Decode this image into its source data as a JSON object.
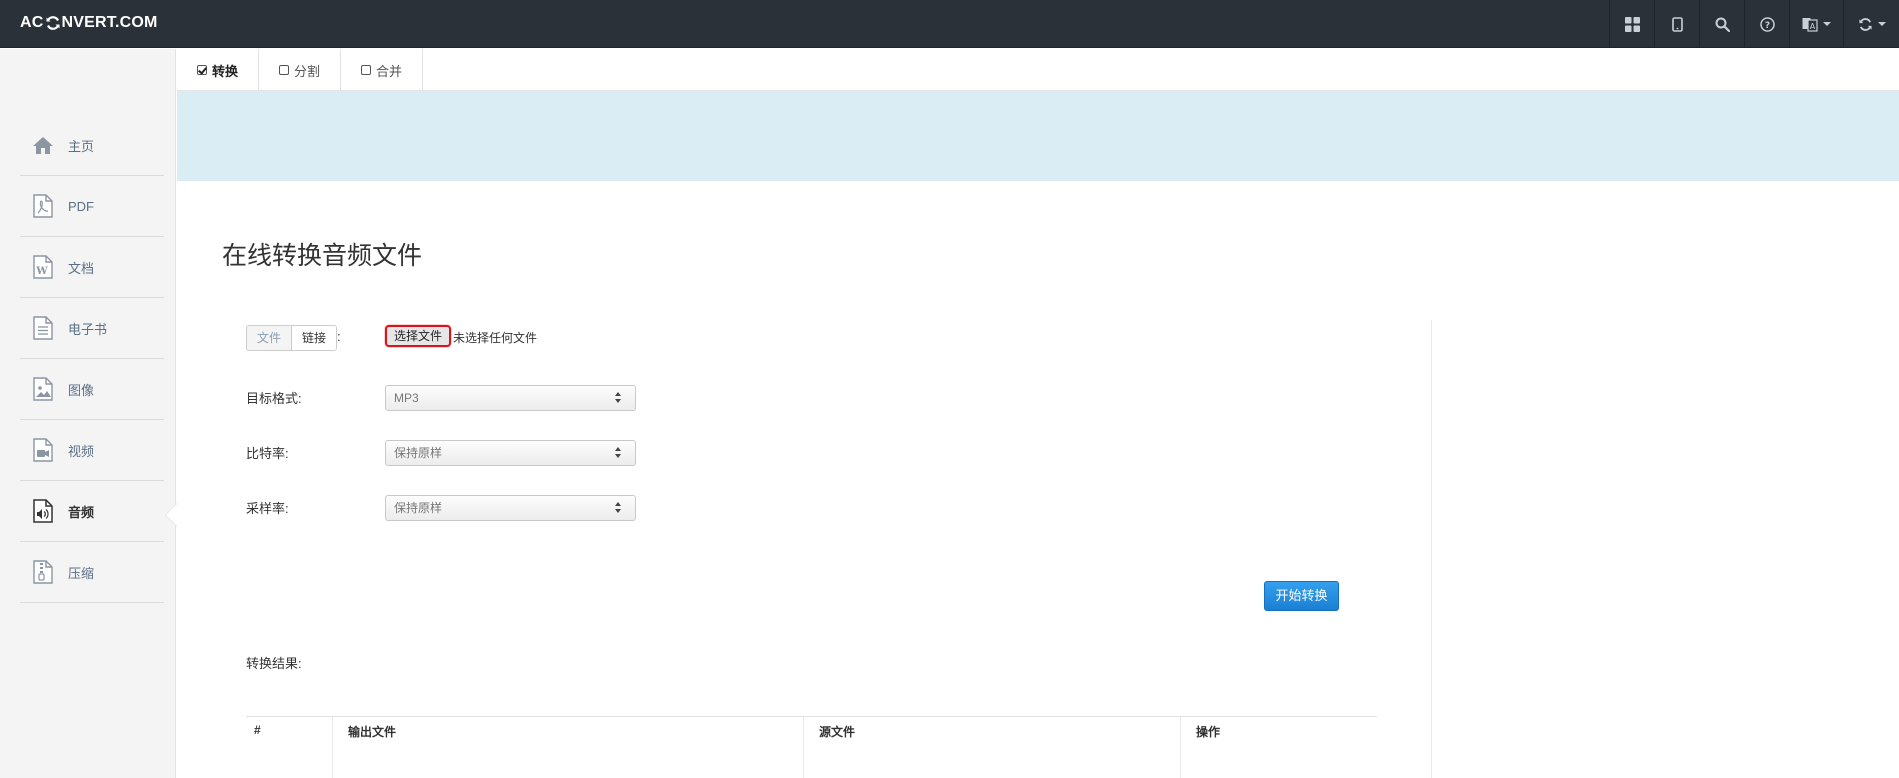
{
  "brand": {
    "left": "AC",
    "right": "NVERT.COM"
  },
  "topbar": {
    "icons": [
      "grid-icon",
      "tablet-icon",
      "search-icon",
      "help-icon",
      "language-icon",
      "refresh-icon"
    ]
  },
  "sidebar": {
    "items": [
      {
        "label": "主页",
        "icon": "home-icon"
      },
      {
        "label": "PDF",
        "icon": "pdf-file-icon"
      },
      {
        "label": "文档",
        "icon": "word-file-icon"
      },
      {
        "label": "电子书",
        "icon": "ebook-file-icon"
      },
      {
        "label": "图像",
        "icon": "image-file-icon"
      },
      {
        "label": "视频",
        "icon": "video-file-icon"
      },
      {
        "label": "音频",
        "icon": "audio-file-icon",
        "active": true
      },
      {
        "label": "压缩",
        "icon": "archive-file-icon"
      }
    ]
  },
  "tabs": [
    {
      "label": "转换",
      "checked": true
    },
    {
      "label": "分割",
      "checked": false
    },
    {
      "label": "合并",
      "checked": false
    }
  ],
  "main": {
    "title": "在线转换音频文件",
    "source_toggle": {
      "file": "文件",
      "link": "链接",
      "colon": ":"
    },
    "choose_file_button": "选择文件",
    "no_file_text": "未选择任何文件",
    "fields": [
      {
        "label": "目标格式:",
        "value": "MP3"
      },
      {
        "label": "比特率:",
        "value": "保持原样"
      },
      {
        "label": "采样率:",
        "value": "保持原样"
      }
    ],
    "start_button": "开始转换",
    "result_label": "转换结果:",
    "table_headers": [
      "#",
      "输出文件",
      "源文件",
      "操作"
    ]
  },
  "colors": {
    "topbar": "#2a3139",
    "banner": "#daedf5",
    "primary_button": "#1a7fd3",
    "highlight_border": "#d9141a"
  }
}
